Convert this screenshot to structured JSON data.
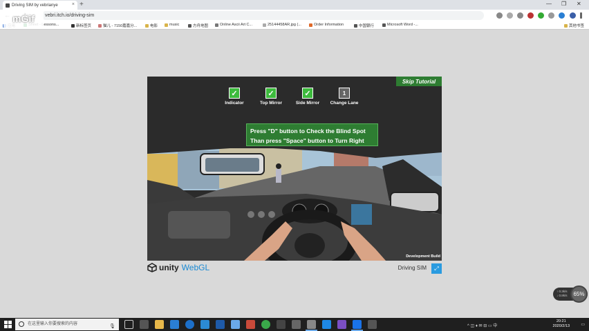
{
  "browser": {
    "tab_title": "Driving SIM by vebrianye",
    "tab_close": "×",
    "new_tab": "+",
    "url": "vebri.itch.io/driving-sim",
    "window_controls": [
      "—",
      "❐",
      "✕"
    ],
    "nav": [
      "←",
      "→",
      "↻"
    ],
    "bookmarks": [
      "应用",
      "Sheet - Lessons...",
      "新标签页",
      "猫儿 - 7150嘉嘉分...",
      "电影",
      "music",
      "方舟地图",
      "Online Ascii Art C...",
      "25144458AR.jpg (...",
      "Order Information",
      "中国银行",
      "Microsoft Word -..."
    ],
    "other_bookmarks": "其他书签",
    "logo_overlay": "mGif"
  },
  "game": {
    "skip_button": "Skip Tutorial",
    "steps": [
      {
        "label": "Indicator",
        "mark": "✓",
        "done": true
      },
      {
        "label": "Top Mirror",
        "mark": "✓",
        "done": true
      },
      {
        "label": "Side Mirror",
        "mark": "✓",
        "done": true
      },
      {
        "label": "Change Lane",
        "mark": "1",
        "done": false
      }
    ],
    "instruction_line1": "Press \"D\" button to Check the Blind Spot",
    "instruction_line2": "Than press \"Space\" button to Turn Right",
    "dev_build": "Development Build"
  },
  "unity": {
    "brand": "unity",
    "webgl": "WebGL",
    "title": "Driving SIM",
    "fullscreen_icon": "⤢"
  },
  "net_widget": {
    "up": "↑ 0.3k/s",
    "down": "↓ 0.8k/s",
    "percent": "65%"
  },
  "taskbar": {
    "search_placeholder": "在这里输入你要搜索的内容",
    "mic": "🎙",
    "time": "20:21",
    "date": "2020/2/13",
    "tray_icons": "^ ◫ ♦ ✉ ⊟ ▭ 中"
  },
  "colors": {
    "accent_green": "#2e7d32",
    "check_green": "#3dbb3d",
    "unity_blue": "#2a9be0"
  }
}
